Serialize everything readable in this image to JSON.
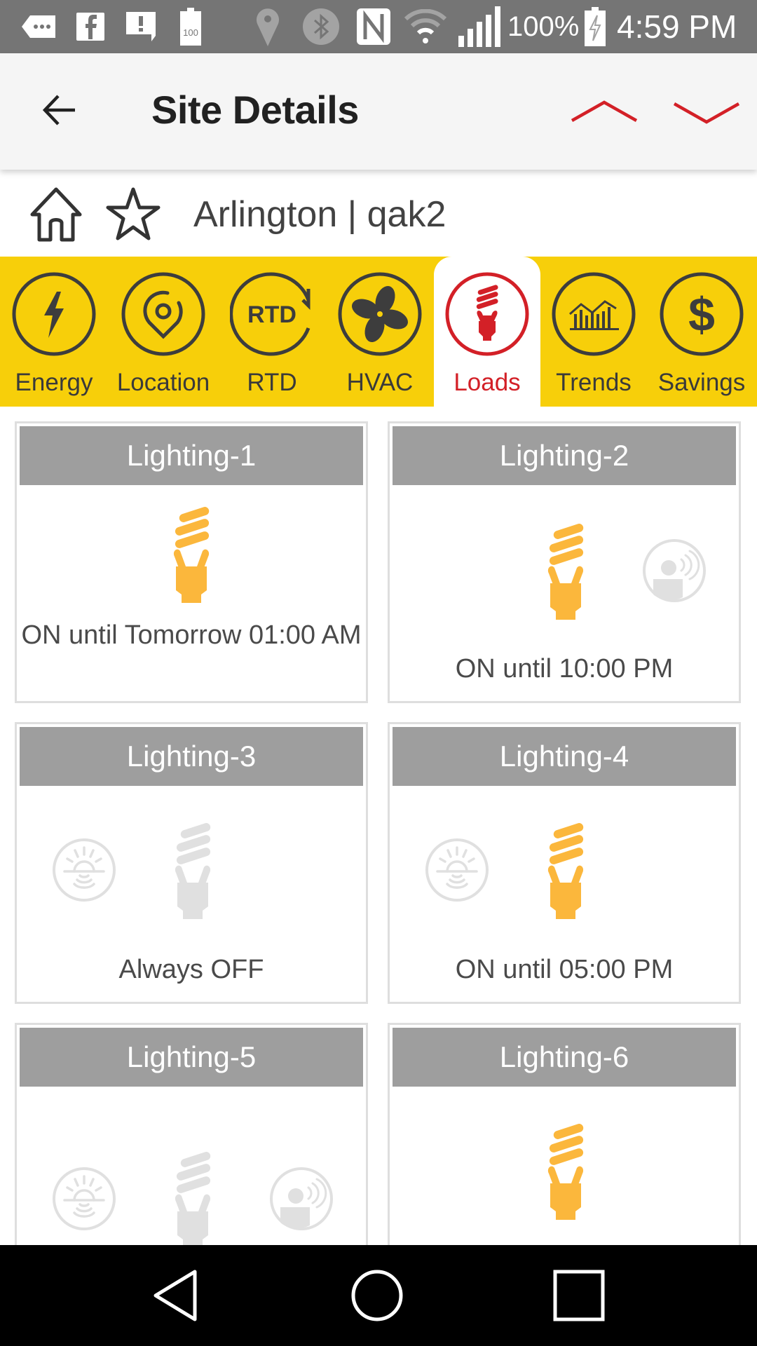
{
  "status_bar": {
    "notification_icons": [
      "more-notifications-icon",
      "facebook-icon",
      "alert-message-icon",
      "battery-100-icon"
    ],
    "system_icons": [
      "location-icon",
      "bluetooth-icon",
      "nfc-icon",
      "wifi-icon",
      "signal-icon"
    ],
    "battery_percent": "100%",
    "time": "4:59 PM"
  },
  "app_bar": {
    "title": "Site Details",
    "back_icon": "arrow-left-icon",
    "prev_icon": "chevron-up-icon",
    "next_icon": "chevron-down-icon",
    "accent_color": "#d32027"
  },
  "site": {
    "name": "Arlington | qak2",
    "home_icon": "home-icon",
    "favorite_icon": "star-outline-icon"
  },
  "tabs": {
    "background_color": "#f7cf0a",
    "active_index": 4,
    "items": [
      {
        "label": "Energy",
        "icon": "lightning-icon"
      },
      {
        "label": "Location",
        "icon": "map-pin-icon"
      },
      {
        "label": "RTD",
        "icon": "rtd-refresh-icon",
        "icon_text": "RTD"
      },
      {
        "label": "HVAC",
        "icon": "fan-icon"
      },
      {
        "label": "Loads",
        "icon": "bulb-icon"
      },
      {
        "label": "Trends",
        "icon": "bar-chart-icon"
      },
      {
        "label": "Savings",
        "icon": "dollar-icon",
        "icon_text": "$"
      }
    ]
  },
  "loads": {
    "on_color": "#fbb73c",
    "off_color": "#e0e0e0",
    "items": [
      {
        "name": "Lighting-1",
        "state": "on",
        "status": "ON until Tomorrow 01:00 AM",
        "daylight_sensor": false,
        "occupancy_sensor": false
      },
      {
        "name": "Lighting-2",
        "state": "on",
        "status": "ON until 10:00 PM",
        "daylight_sensor": false,
        "occupancy_sensor": true
      },
      {
        "name": "Lighting-3",
        "state": "off",
        "status": "Always OFF",
        "daylight_sensor": true,
        "occupancy_sensor": false
      },
      {
        "name": "Lighting-4",
        "state": "on",
        "status": "ON until 05:00 PM",
        "daylight_sensor": true,
        "occupancy_sensor": false
      },
      {
        "name": "Lighting-5",
        "state": "off",
        "status": "",
        "daylight_sensor": true,
        "occupancy_sensor": true
      },
      {
        "name": "Lighting-6",
        "state": "on",
        "status": "",
        "daylight_sensor": false,
        "occupancy_sensor": false
      }
    ]
  },
  "nav_bar": {
    "back": "nav-back-icon",
    "home": "nav-home-icon",
    "recents": "nav-recents-icon"
  }
}
